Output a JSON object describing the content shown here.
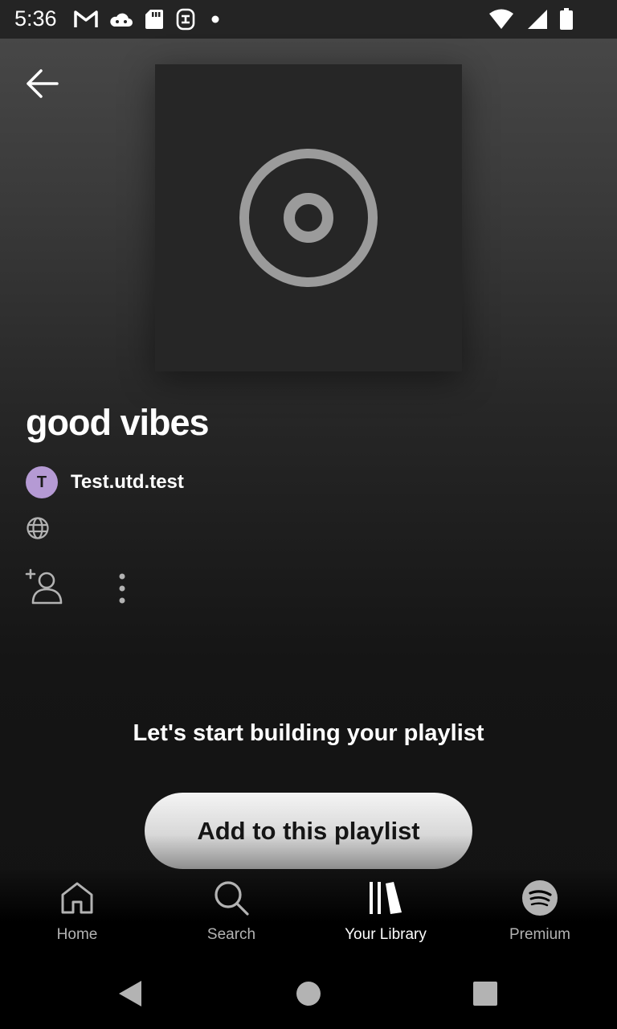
{
  "status_bar": {
    "time": "5:36",
    "left_icons": [
      "gmail-icon",
      "cloud-icon",
      "sd-card-icon",
      "app-icon",
      "dot-icon"
    ],
    "right_icons": [
      "wifi-icon",
      "signal-icon",
      "battery-icon"
    ]
  },
  "playlist": {
    "title": "good vibes",
    "owner_initial": "T",
    "owner_name": "Test.utd.test",
    "visibility_icon": "globe-icon"
  },
  "empty_state": {
    "heading": "Let's start building your playlist",
    "button_label": "Add to this playlist"
  },
  "bottom_nav": {
    "items": [
      {
        "label": "Home",
        "icon": "home-icon"
      },
      {
        "label": "Search",
        "icon": "search-icon"
      },
      {
        "label": "Your Library",
        "icon": "library-icon",
        "active": true
      },
      {
        "label": "Premium",
        "icon": "spotify-icon"
      }
    ]
  },
  "colors": {
    "avatar": "#b59ad4",
    "background_top": "#4a4a4a",
    "background_bottom": "#121212"
  }
}
